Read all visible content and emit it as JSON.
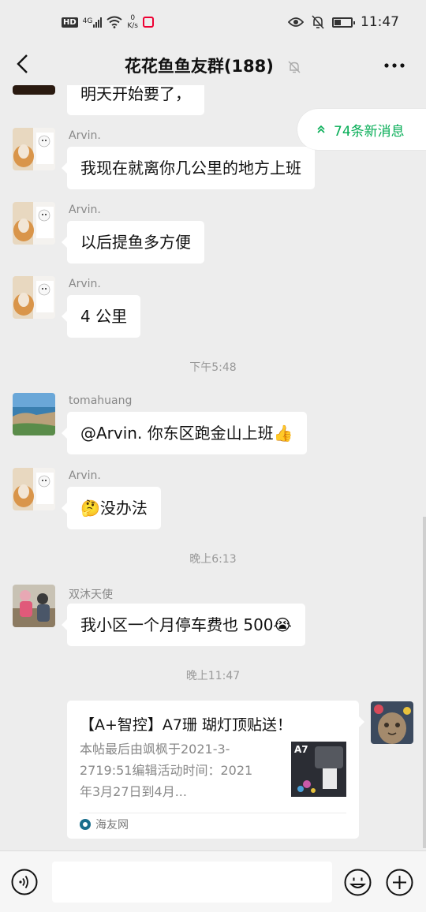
{
  "status_bar": {
    "hd": "HD",
    "network": "4G",
    "speed_value": "0",
    "speed_unit": "K/s",
    "time": "11:47"
  },
  "nav": {
    "title": "花花鱼鱼友群(188)"
  },
  "new_messages_label": "74条新消息",
  "messages": [
    {
      "text": "明天开始要了，"
    },
    {
      "sender": "Arvin.",
      "text": "我现在就离你几公里的地方上班"
    },
    {
      "sender": "Arvin.",
      "text": "以后提鱼多方便"
    },
    {
      "sender": "Arvin.",
      "text": "4 公里"
    },
    {
      "sender": "tomahuang",
      "text": "@Arvin.  你东区跑金山上班👍"
    },
    {
      "sender": "Arvin.",
      "text": "🤔没办法"
    },
    {
      "sender": "双沐天使",
      "text": "我小区一个月停车费也 500😭"
    }
  ],
  "timestamps": [
    "下午5:48",
    "晚上6:13",
    "晚上11:47"
  ],
  "card": {
    "title": "【A+智控】A7珊 瑚灯顶贴送！",
    "description": "本帖最后由飒枫于2021-3-2719:51编辑活动时间：2021年3月27日到4月...",
    "thumb_label": "A7",
    "source": "海友网"
  },
  "colors": {
    "accent_green": "#06ad56",
    "background": "#ededed",
    "bubble": "#ffffff"
  },
  "icons": [
    "back-arrow-icon",
    "mute-bell-icon",
    "more-icon",
    "voice-icon",
    "emoji-icon",
    "plus-icon",
    "double-chevron-up-icon"
  ]
}
